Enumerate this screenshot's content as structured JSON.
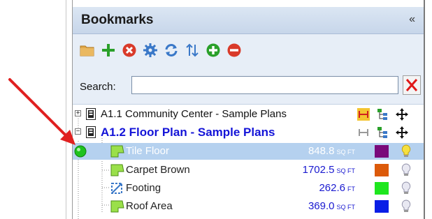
{
  "panel": {
    "title": "Bookmarks",
    "collapse_glyph": "«"
  },
  "toolbar": {
    "icons": [
      "folder-icon",
      "add-icon",
      "delete-icon",
      "settings-gear-icon",
      "refresh-icon",
      "sort-icon",
      "expand-all-icon",
      "collapse-all-icon"
    ]
  },
  "search": {
    "label": "Search:",
    "value": ""
  },
  "tree": {
    "groups": [
      {
        "label": "A1.1 Community Center - Sample Plans",
        "expanded": false
      },
      {
        "label": "A1.2 Floor Plan - Sample Plans",
        "expanded": true
      }
    ],
    "items": [
      {
        "label": "Tile Floor",
        "value": "848.8",
        "unit": "SQ FT",
        "color": "#7a0a7a",
        "selected": true
      },
      {
        "label": "Carpet Brown",
        "value": "1702.5",
        "unit": "SQ FT",
        "color": "#dc5a0a",
        "selected": false
      },
      {
        "label": "Footing",
        "value": "262.6",
        "unit": "FT",
        "color": "#1ee61e",
        "selected": false
      },
      {
        "label": "Roof Area",
        "value": "369.0",
        "unit": "SQ FT",
        "color": "#0a1ee6",
        "selected": false
      }
    ]
  },
  "colors": {
    "header_bg": "#c7d6ea",
    "selected_row": "#b5d1ef",
    "group_bold_text": "#1414d8",
    "annotation_arrow": "#e02020"
  }
}
